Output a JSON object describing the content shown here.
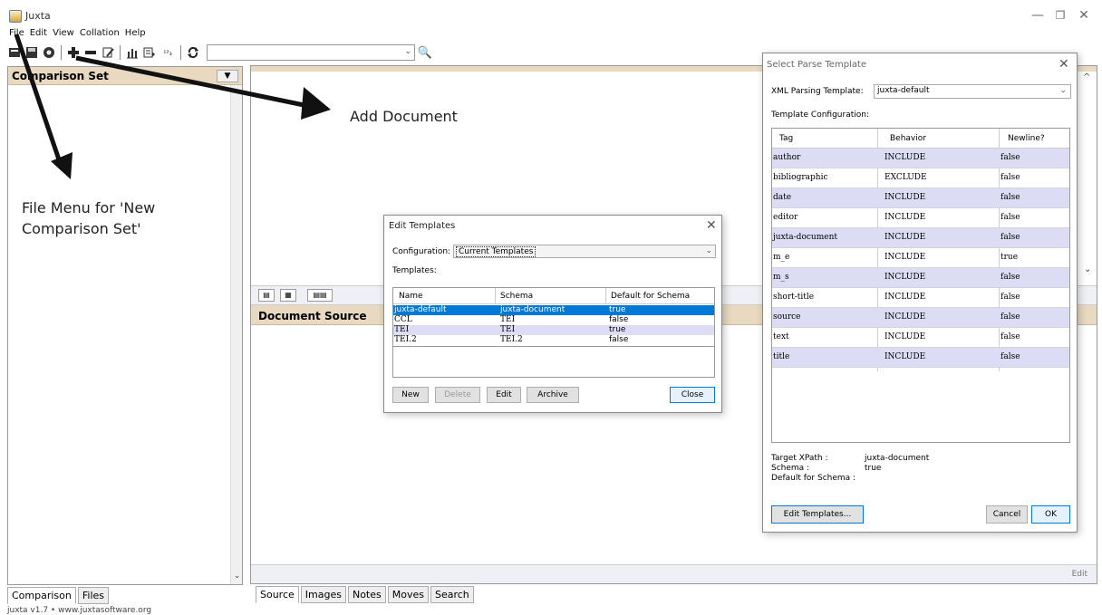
{
  "window": {
    "title": "Juxta"
  },
  "menu": [
    "File",
    "Edit",
    "View",
    "Collation",
    "Help"
  ],
  "toolbar": {
    "icons": [
      "new-icon",
      "save-icon",
      "settings-icon",
      "add-document-icon",
      "remove-document-icon",
      "edit-document-icon",
      "chart-icon",
      "export-icon",
      "numbering-icon",
      "refresh-icon"
    ],
    "search_value": "",
    "search_glyph": "🔍",
    "dropdown_glyph": "⌄",
    "numbering_glyph": "¹²₃"
  },
  "left_panel": {
    "title": "Comparison Set",
    "tabs": [
      "Comparison",
      "Files"
    ]
  },
  "right_panel": {
    "document_source_title": "Document Source",
    "edit_label": "Edit",
    "tabs": [
      "Source",
      "Images",
      "Notes",
      "Moves",
      "Search"
    ]
  },
  "status_bar": "juxta v1.7 • www.juxtasoftware.org",
  "annotations": {
    "add_document": "Add Document",
    "file_menu_line1": "File Menu for 'New",
    "file_menu_line2": "Comparison Set'"
  },
  "edit_templates_dialog": {
    "title": "Edit Templates",
    "configuration_label": "Configuration:",
    "configuration_value": "Current Templates",
    "templates_label": "Templates:",
    "columns": [
      "Name",
      "Schema",
      "Default for Schema"
    ],
    "rows": [
      {
        "name": "juxta-default",
        "schema": "juxta-document",
        "default": "true",
        "selected": true
      },
      {
        "name": "CCL",
        "schema": "TEI",
        "default": "false",
        "selected": false
      },
      {
        "name": "TEI",
        "schema": "TEI",
        "default": "true",
        "selected": false,
        "highlight": true
      },
      {
        "name": "TEI.2",
        "schema": "TEI.2",
        "default": "false",
        "selected": false
      }
    ],
    "buttons": {
      "new": "New",
      "delete": "Delete",
      "edit": "Edit",
      "archive": "Archive",
      "close": "Close"
    }
  },
  "parse_template_dialog": {
    "title": "Select Parse Template",
    "xml_label": "XML Parsing Template:",
    "xml_value": "juxta-default",
    "config_label": "Template Configuration:",
    "columns": [
      "Tag",
      "Behavior",
      "Newline?"
    ],
    "rows": [
      {
        "tag": "author",
        "behavior": "INCLUDE",
        "newline": "false",
        "hl": true
      },
      {
        "tag": "bibliographic",
        "behavior": "EXCLUDE",
        "newline": "false",
        "hl": false
      },
      {
        "tag": "date",
        "behavior": "INCLUDE",
        "newline": "false",
        "hl": true
      },
      {
        "tag": "editor",
        "behavior": "INCLUDE",
        "newline": "false",
        "hl": false
      },
      {
        "tag": "juxta-document",
        "behavior": "INCLUDE",
        "newline": "false",
        "hl": true
      },
      {
        "tag": "m_e",
        "behavior": "INCLUDE",
        "newline": "true",
        "hl": false
      },
      {
        "tag": "m_s",
        "behavior": "INCLUDE",
        "newline": "false",
        "hl": true
      },
      {
        "tag": "short-title",
        "behavior": "INCLUDE",
        "newline": "false",
        "hl": false
      },
      {
        "tag": "source",
        "behavior": "INCLUDE",
        "newline": "false",
        "hl": true
      },
      {
        "tag": "text",
        "behavior": "INCLUDE",
        "newline": "false",
        "hl": false
      },
      {
        "tag": "title",
        "behavior": "INCLUDE",
        "newline": "false",
        "hl": true
      }
    ],
    "target_xpath_label": "Target XPath :",
    "target_xpath_value": "juxta-document",
    "schema_label": "Schema :",
    "schema_value": "true",
    "default_schema_label": "Default for Schema :",
    "buttons": {
      "edit_templates": "Edit Templates...",
      "cancel": "Cancel",
      "ok": "OK"
    }
  },
  "colors": {
    "panel_header": "#e8d9c0",
    "selection": "#0078d7",
    "row_highlight": "#dcdcf4"
  }
}
